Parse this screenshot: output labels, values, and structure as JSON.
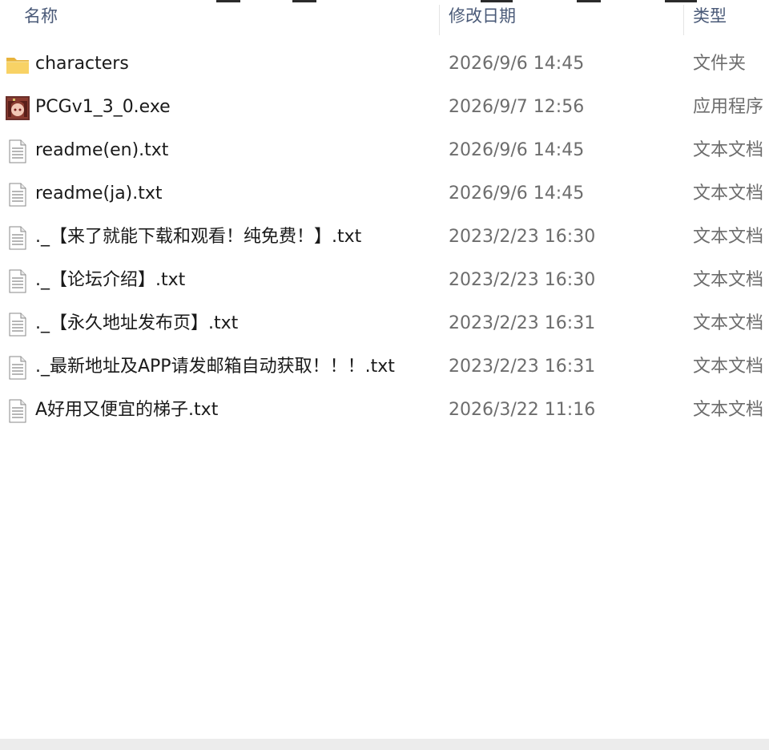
{
  "columns": {
    "name": "名称",
    "date": "修改日期",
    "type": "类型"
  },
  "files": [
    {
      "icon": "folder-icon",
      "name": "characters",
      "date": "2026/9/6 14:45",
      "type": "文件夹"
    },
    {
      "icon": "app-icon",
      "name": "PCGv1_3_0.exe",
      "date": "2026/9/7 12:56",
      "type": "应用程序"
    },
    {
      "icon": "text-file-icon",
      "name": "readme(en).txt",
      "date": "2026/9/6 14:45",
      "type": "文本文档"
    },
    {
      "icon": "text-file-icon",
      "name": "readme(ja).txt",
      "date": "2026/9/6 14:45",
      "type": "文本文档"
    },
    {
      "icon": "text-file-icon",
      "name": "._【来了就能下载和观看！纯免费！】.txt",
      "date": "2023/2/23 16:30",
      "type": "文本文档"
    },
    {
      "icon": "text-file-icon",
      "name": "._【论坛介绍】.txt",
      "date": "2023/2/23 16:30",
      "type": "文本文档"
    },
    {
      "icon": "text-file-icon",
      "name": "._【永久地址发布页】.txt",
      "date": "2023/2/23 16:31",
      "type": "文本文档"
    },
    {
      "icon": "text-file-icon",
      "name": "._最新地址及APP请发邮箱自动获取！！！.txt",
      "date": "2023/2/23 16:31",
      "type": "文本文档"
    },
    {
      "icon": "text-file-icon",
      "name": "A好用又便宜的梯子.txt",
      "date": "2026/3/22 11:16",
      "type": "文本文档"
    }
  ]
}
